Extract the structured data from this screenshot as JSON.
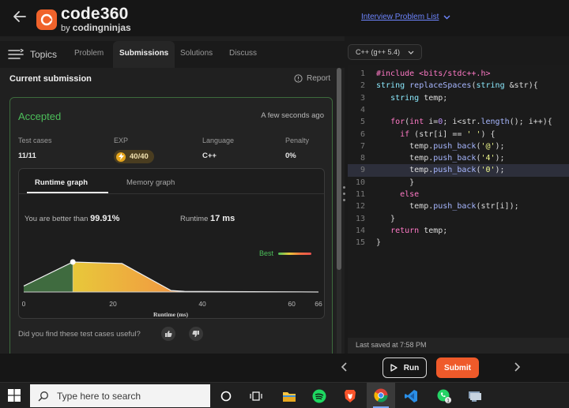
{
  "header": {
    "logo_main": "code360",
    "logo_by": "by",
    "logo_brand": "codingninjas",
    "problem_list_link": "Interview Problem List"
  },
  "tabs": {
    "topics": "Topics",
    "problem": "Problem",
    "submissions": "Submissions",
    "solutions": "Solutions",
    "discuss": "Discuss"
  },
  "submission": {
    "section_title": "Current submission",
    "report_label": "Report",
    "status": "Accepted",
    "time_ago": "A few seconds ago",
    "stats": {
      "test_cases_label": "Test cases",
      "test_cases_value": "11/11",
      "exp_label": "EXP",
      "exp_value": "40/40",
      "language_label": "Language",
      "language_value": "C++",
      "penalty_label": "Penalty",
      "penalty_value": "0%"
    },
    "graph": {
      "tab_runtime": "Runtime graph",
      "tab_memory": "Memory graph",
      "better_prefix": "You are better than",
      "better_value": "99.91%",
      "runtime_prefix": "Runtime",
      "runtime_value": "17 ms",
      "legend_best": "Best"
    },
    "feedback_question": "Did you find these test cases useful?"
  },
  "chart_data": {
    "type": "area",
    "xlabel": "Runtime (ms)",
    "ylabel": "",
    "x_ticks": [
      "0",
      "20",
      "40",
      "60",
      "66"
    ],
    "xlim": [
      0,
      66
    ],
    "x": [
      0,
      11,
      22,
      33,
      36,
      66
    ],
    "y": [
      0.2,
      1.0,
      0.95,
      0.05,
      0.02,
      0.0
    ],
    "marker": {
      "x": 11,
      "label": ""
    },
    "gradient": [
      "#4cbe5a",
      "#e8c83a",
      "#f07040",
      "#e85050"
    ]
  },
  "editor": {
    "language": "C++ (g++ 5.4)",
    "highlighted_line": 9,
    "last_saved": "Last saved at 7:58 PM",
    "lines": [
      {
        "n": "1",
        "t": "#include <bits/stdc++.h>"
      },
      {
        "n": "2",
        "t": "string replaceSpaces(string &str){"
      },
      {
        "n": "3",
        "t": "   string temp;"
      },
      {
        "n": "4",
        "t": ""
      },
      {
        "n": "5",
        "t": "   for(int i=0; i<str.length(); i++){"
      },
      {
        "n": "6",
        "t": "     if (str[i] == ' ') {"
      },
      {
        "n": "7",
        "t": "       temp.push_back('@');"
      },
      {
        "n": "8",
        "t": "       temp.push_back('4');"
      },
      {
        "n": "9",
        "t": "       temp.push_back('0');"
      },
      {
        "n": "10",
        "t": "       }"
      },
      {
        "n": "11",
        "t": "     else"
      },
      {
        "n": "12",
        "t": "       temp.push_back(str[i]);"
      },
      {
        "n": "13",
        "t": "   }"
      },
      {
        "n": "14",
        "t": "   return temp;"
      },
      {
        "n": "15",
        "t": "}"
      }
    ]
  },
  "actions": {
    "run": "Run",
    "submit": "Submit"
  },
  "taskbar": {
    "search_placeholder": "Type here to search",
    "whatsapp_badge": "1"
  }
}
